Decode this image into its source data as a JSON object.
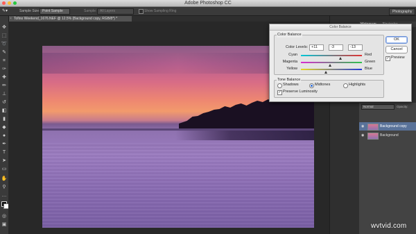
{
  "window": {
    "title": "Adobe Photoshop CC"
  },
  "options_bar": {
    "sample_size_label": "Sample Size:",
    "sample_size_value": "Point Sample",
    "sample_label": "Sample:",
    "sample_value": "All Layers",
    "show_ring_label": "Show Sampling Ring",
    "workspace": "Photography"
  },
  "document_tab": {
    "label": "Tofino Weekend_1676.NEF @ 12.5% (Background copy, RGB/8*) *"
  },
  "panels": {
    "tabs": [
      "Histogram",
      "Navigator"
    ],
    "blend_mode": "Normal",
    "opacity_label": "Opacity:",
    "layers": [
      {
        "name": "Background copy",
        "active": true
      },
      {
        "name": "Background",
        "active": false
      }
    ]
  },
  "dialog": {
    "title": "Color Balance",
    "color_balance_group": "Color Balance",
    "color_levels_label": "Color Levels:",
    "levels": [
      "+11",
      "-3",
      "-13"
    ],
    "sliders": [
      {
        "left": "Cyan",
        "right": "Red",
        "value": 11
      },
      {
        "left": "Magenta",
        "right": "Green",
        "value": -3
      },
      {
        "left": "Yellow",
        "right": "Blue",
        "value": -13
      }
    ],
    "tone_group": "Tone Balance",
    "tones": [
      "Shadows",
      "Midtones",
      "Highlights"
    ],
    "selected_tone": "Midtones",
    "preserve_label": "Preserve Luminosity",
    "ok_label": "OK",
    "cancel_label": "Cancel",
    "preview_label": "Preview"
  },
  "watermark": "wvtvid.com"
}
